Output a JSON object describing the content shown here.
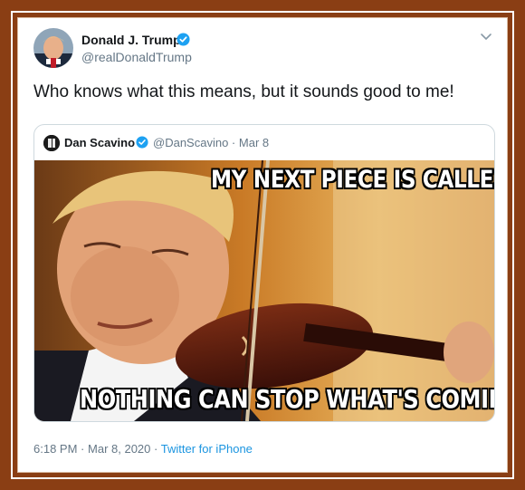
{
  "tweet": {
    "author_name": "Donald J. Trump",
    "author_handle": "@realDonaldTrump",
    "text": "Who knows what this means, but it sounds good to me!",
    "time": "6:18 PM",
    "separator": "·",
    "date": "Mar 8, 2020",
    "source": "Twitter for iPhone"
  },
  "quoted": {
    "author_name": "Dan Scavino",
    "author_handle": "@DanScavino",
    "separator": "·",
    "date": "Mar 8",
    "meme_top": "MY NEXT PIECE IS CALLED",
    "meme_bottom": "NOTHING CAN STOP WHAT'S COMING"
  },
  "colors": {
    "frame": "#8a3e14",
    "verified": "#1da1f2",
    "link": "#1b95e0",
    "secondary_text": "#657786"
  },
  "icons": {
    "verified": "verified-badge-icon",
    "menu": "chevron-down-icon"
  }
}
